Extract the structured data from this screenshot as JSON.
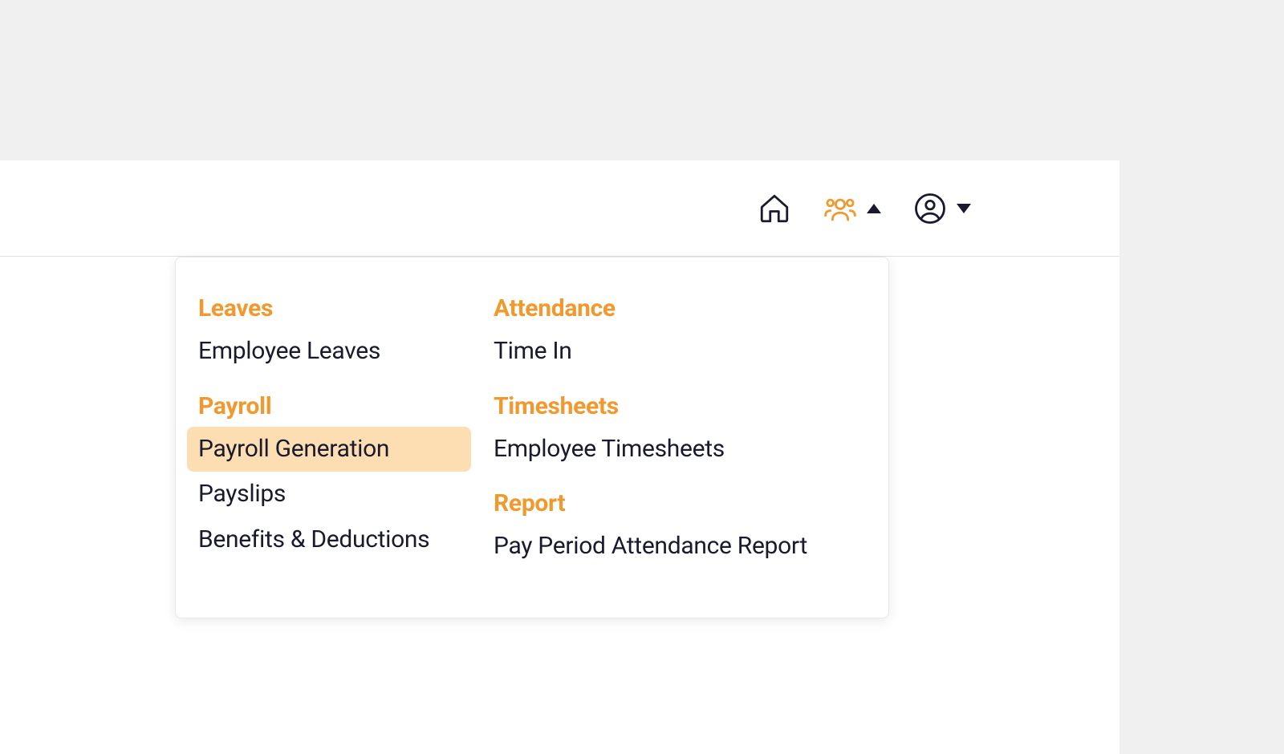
{
  "colors": {
    "accent": "#f0992f",
    "highlight_bg": "#fcdeb2",
    "text": "#1a1a2e"
  },
  "menu": {
    "left": [
      {
        "heading": "Leaves",
        "items": [
          {
            "label": "Employee Leaves",
            "highlighted": false
          }
        ]
      },
      {
        "heading": "Payroll",
        "items": [
          {
            "label": "Payroll Generation",
            "highlighted": true
          },
          {
            "label": "Payslips",
            "highlighted": false
          },
          {
            "label": "Benefits & Deductions",
            "highlighted": false
          }
        ]
      }
    ],
    "right": [
      {
        "heading": "Attendance",
        "items": [
          {
            "label": "Time In",
            "highlighted": false
          }
        ]
      },
      {
        "heading": "Timesheets",
        "items": [
          {
            "label": "Employee Timesheets",
            "highlighted": false
          }
        ]
      },
      {
        "heading": "Report",
        "items": [
          {
            "label": "Pay Period Attendance Report",
            "highlighted": false
          }
        ]
      }
    ]
  }
}
